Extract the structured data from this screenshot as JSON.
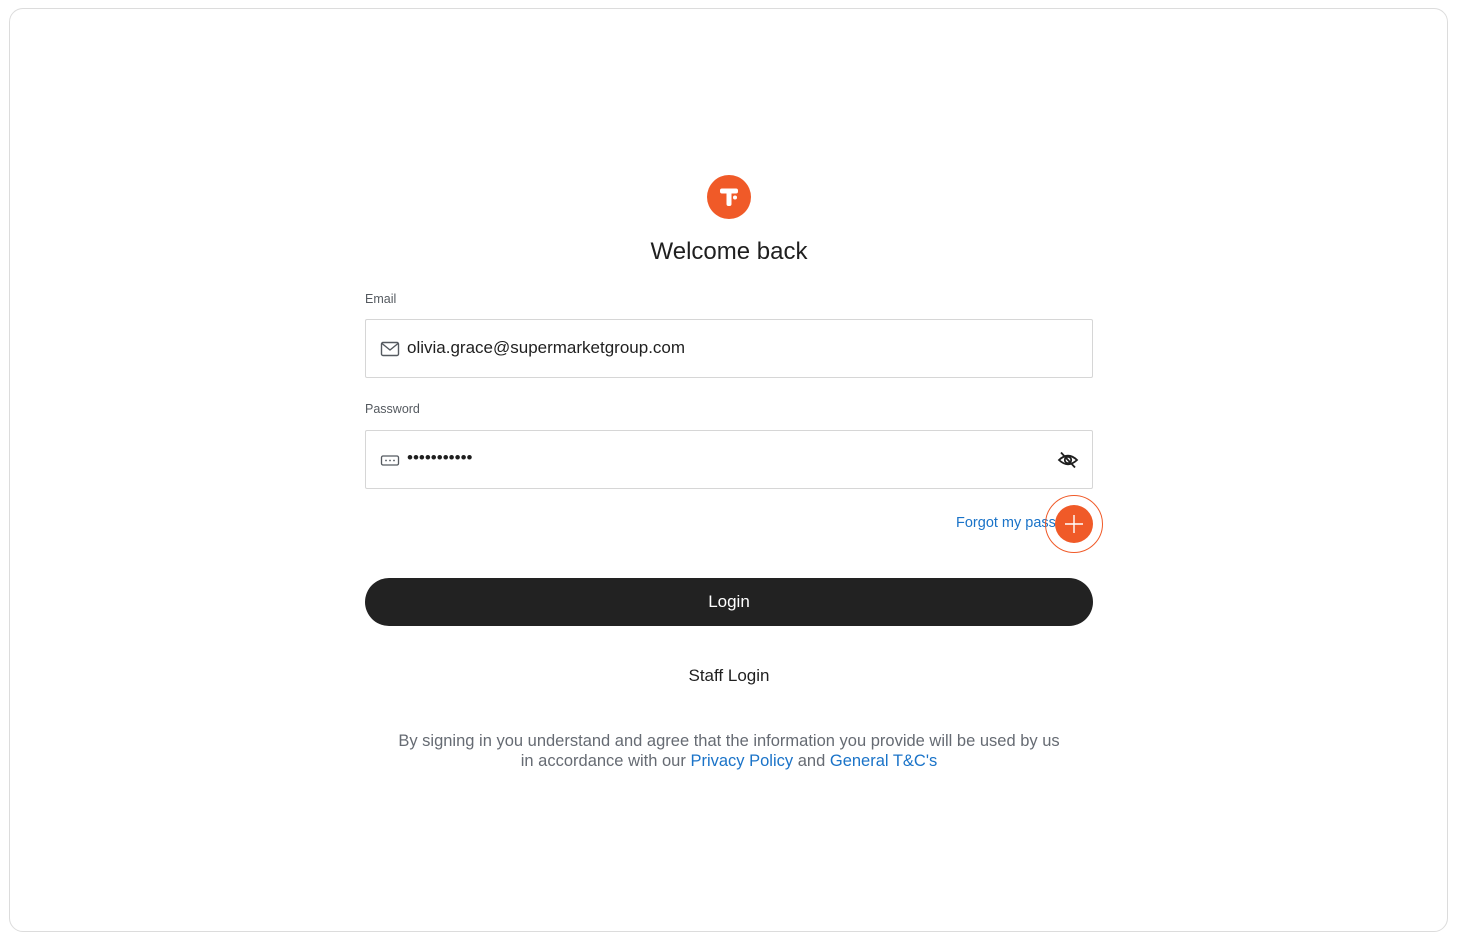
{
  "brand": {
    "logo_icon": "brand-t-logo-icon",
    "accent_color": "#f05a28"
  },
  "header": {
    "title": "Welcome back"
  },
  "form": {
    "email": {
      "label": "Email",
      "value": "olivia.grace@supermarketgroup.com",
      "icon": "mail-icon"
    },
    "password": {
      "label": "Password",
      "value": "•••••••••••",
      "icon": "password-icon",
      "toggle_icon": "eye-slash-icon"
    },
    "forgot_password_label": "Forgot my pass",
    "login_label": "Login",
    "staff_login_label": "Staff Login"
  },
  "legal": {
    "line1": "By signing in you understand and agree that the information you provide will be used by us",
    "line2_prefix": "in accordance with our",
    "privacy_label": "Privacy Policy",
    "and_text": "and",
    "terms_label": "General T&C's"
  },
  "colors": {
    "primary_button": "#222222",
    "link": "#1a73c8",
    "muted_text": "#666b73"
  }
}
